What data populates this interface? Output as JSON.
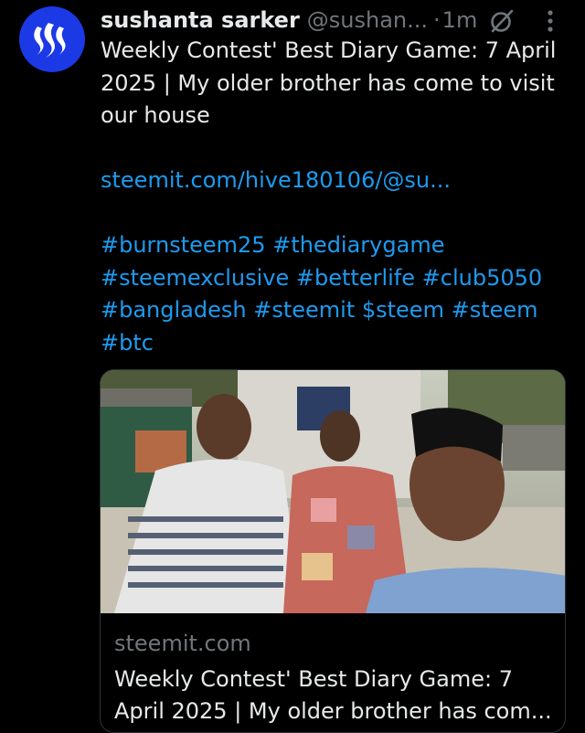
{
  "post": {
    "author_name": "sushanta sarker",
    "handle": "@sushan...",
    "separator": "·",
    "time": "1m",
    "title_line": "Weekly Contest' Best Diary Game: 7 April 2025 | My older brother has come to visit our house",
    "link": "steemit.com/hive180106/@su...",
    "hashtags_line1": "#burnsteem25 #thediarygame",
    "hashtags_line2": "#steemexclusive #betterlife #club5050",
    "hashtags_line3": "#bangladesh #steemit $steem #steem",
    "hashtags_line4": "#btc"
  },
  "card": {
    "domain": "steemit.com",
    "title": "Weekly Contest' Best Diary Game: 7 April 2025 | My older brother has com..."
  },
  "icons": {
    "avatar": "steem-logo-icon",
    "grok": "grok-icon",
    "more": "more-vertical-icon"
  },
  "colors": {
    "background": "#000000",
    "text": "#e7e9ea",
    "muted": "#71767b",
    "link": "#1d9bf0",
    "avatar_bg": "#1c39e6"
  }
}
